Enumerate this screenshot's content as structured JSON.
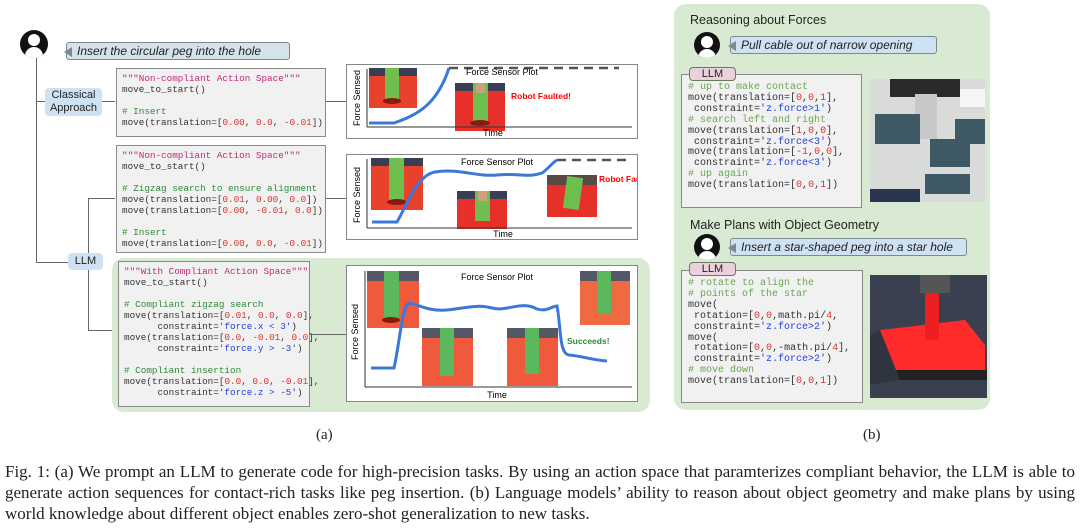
{
  "panel_a": {
    "user_prompt": "Insert the circular peg into the hole",
    "classical_label": "Classical Approach",
    "llm_label": "LLM",
    "code_blocks": [
      [
        [
          [
            "s",
            "\"\"\"Non-compliant Action Space\"\"\""
          ]
        ],
        [
          [
            "d",
            "move_to_start()"
          ]
        ],
        [],
        [
          [
            "c",
            "# Insert"
          ]
        ],
        [
          [
            "d",
            "move(translation=["
          ],
          [
            "n",
            "0.00"
          ],
          [
            "d",
            ", "
          ],
          [
            "n",
            "0.0"
          ],
          [
            "d",
            ", "
          ],
          [
            "n",
            "-0.01"
          ],
          [
            "d",
            "])"
          ]
        ]
      ],
      [
        [
          [
            "s",
            "\"\"\"Non-compliant Action Space\"\"\""
          ]
        ],
        [
          [
            "d",
            "move_to_start()"
          ]
        ],
        [],
        [
          [
            "c",
            "# Zigzag search to ensure alignment"
          ]
        ],
        [
          [
            "d",
            "move(translation=["
          ],
          [
            "n",
            "0.01"
          ],
          [
            "d",
            ", "
          ],
          [
            "n",
            "0.00"
          ],
          [
            "d",
            ", "
          ],
          [
            "n",
            "0.0"
          ],
          [
            "d",
            "])"
          ]
        ],
        [
          [
            "d",
            "move(translation=["
          ],
          [
            "n",
            "0.00"
          ],
          [
            "d",
            ", "
          ],
          [
            "n",
            "-0.01"
          ],
          [
            "d",
            ", "
          ],
          [
            "n",
            "0.0"
          ],
          [
            "d",
            "])"
          ]
        ],
        [],
        [
          [
            "c",
            "# Insert"
          ]
        ],
        [
          [
            "d",
            "move(translation=["
          ],
          [
            "n",
            "0.00"
          ],
          [
            "d",
            ", "
          ],
          [
            "n",
            "0.0"
          ],
          [
            "d",
            ", "
          ],
          [
            "n",
            "-0.01"
          ],
          [
            "d",
            "])"
          ]
        ]
      ],
      [
        [
          [
            "s",
            "\"\"\"With Compliant Action Space\"\"\""
          ]
        ],
        [
          [
            "d",
            "move_to_start()"
          ]
        ],
        [],
        [
          [
            "c",
            "# Compliant zigzag search"
          ]
        ],
        [
          [
            "d",
            "move(translation=["
          ],
          [
            "n",
            "0.01"
          ],
          [
            "d",
            ", "
          ],
          [
            "n",
            "0.0"
          ],
          [
            "d",
            ", "
          ],
          [
            "n",
            "0.0"
          ],
          [
            "d",
            "],"
          ]
        ],
        [
          [
            "d",
            "      constraint="
          ],
          [
            "q",
            "'force.x < 3'"
          ],
          [
            "d",
            ")"
          ]
        ],
        [
          [
            "d",
            "move(translation=["
          ],
          [
            "n",
            "0.0"
          ],
          [
            "d",
            ", "
          ],
          [
            "n",
            "-0.01"
          ],
          [
            "d",
            ", "
          ],
          [
            "n",
            "0.0"
          ],
          [
            "d",
            "],"
          ]
        ],
        [
          [
            "d",
            "      constraint="
          ],
          [
            "q",
            "'force.y > -3'"
          ],
          [
            "d",
            ")"
          ]
        ],
        [],
        [
          [
            "c",
            "# Compliant insertion"
          ]
        ],
        [
          [
            "d",
            "move(translation=["
          ],
          [
            "n",
            "0.0"
          ],
          [
            "d",
            ", "
          ],
          [
            "n",
            "0.0"
          ],
          [
            "d",
            ", "
          ],
          [
            "n",
            "-0.01"
          ],
          [
            "d",
            "],"
          ]
        ],
        [
          [
            "d",
            "      constraint="
          ],
          [
            "q",
            "'force.z > -5'"
          ],
          [
            "d",
            ")"
          ]
        ]
      ]
    ],
    "plots": [
      {
        "title": "Force Sensor Plot",
        "ylabel": "Force Sensed",
        "xlabel": "Time",
        "status": "Robot Faulted!",
        "status_color": "#ff0000"
      },
      {
        "title": "Force Sensor Plot",
        "ylabel": "Force Sensed",
        "xlabel": "Time",
        "status": "Robot Faulted!",
        "status_color": "#ff0000"
      },
      {
        "title": "Force Sensor Plot",
        "ylabel": "Force Sensed",
        "xlabel": "Time",
        "status": "Succeeds!",
        "status_color": "#2e8b3a"
      }
    ],
    "sublabel": "(a)"
  },
  "panel_b": {
    "sections": [
      {
        "title": "Reasoning about Forces",
        "user_prompt": "Pull cable out of narrow opening",
        "llm_label": "LLM",
        "code": [
          [
            [
              "c",
              "# up to make contact"
            ]
          ],
          [
            [
              "d",
              "move(translation=["
            ],
            [
              "n",
              "0"
            ],
            [
              "d",
              ","
            ],
            [
              "n",
              "0"
            ],
            [
              "d",
              ","
            ],
            [
              "n",
              "1"
            ],
            [
              "d",
              "],"
            ]
          ],
          [
            [
              "d",
              " constraint="
            ],
            [
              "q",
              "'z.force>1'"
            ],
            [
              "d",
              ")"
            ]
          ],
          [
            [
              "c",
              "# search left and right"
            ]
          ],
          [
            [
              "d",
              "move(translation=["
            ],
            [
              "n",
              "1"
            ],
            [
              "d",
              ","
            ],
            [
              "n",
              "0"
            ],
            [
              "d",
              ","
            ],
            [
              "n",
              "0"
            ],
            [
              "d",
              "],"
            ]
          ],
          [
            [
              "d",
              " constraint="
            ],
            [
              "q",
              "'z.force<3'"
            ],
            [
              "d",
              ")"
            ]
          ],
          [
            [
              "d",
              "move(translation=["
            ],
            [
              "n",
              "-1"
            ],
            [
              "d",
              ","
            ],
            [
              "n",
              "0"
            ],
            [
              "d",
              ","
            ],
            [
              "n",
              "0"
            ],
            [
              "d",
              "],"
            ]
          ],
          [
            [
              "d",
              " constraint="
            ],
            [
              "q",
              "'z.force<3'"
            ],
            [
              "d",
              ")"
            ]
          ],
          [
            [
              "c",
              "# up again"
            ]
          ],
          [
            [
              "d",
              "move(translation=["
            ],
            [
              "n",
              "0"
            ],
            [
              "d",
              ","
            ],
            [
              "n",
              "0"
            ],
            [
              "d",
              ","
            ],
            [
              "n",
              "1"
            ],
            [
              "d",
              "])"
            ]
          ]
        ]
      },
      {
        "title": "Make Plans with Object Geometry",
        "user_prompt": "Insert a star-shaped peg into a star hole",
        "llm_label": "LLM",
        "code": [
          [
            [
              "c",
              "# rotate to align the"
            ]
          ],
          [
            [
              "c",
              "# points of the star"
            ]
          ],
          [
            [
              "d",
              "move("
            ]
          ],
          [
            [
              "d",
              " rotation=["
            ],
            [
              "n",
              "0"
            ],
            [
              "d",
              ","
            ],
            [
              "n",
              "0"
            ],
            [
              "d",
              ",math.pi/"
            ],
            [
              "n",
              "4"
            ],
            [
              "d",
              ","
            ]
          ],
          [
            [
              "d",
              " constraint="
            ],
            [
              "q",
              "'z.force>2'"
            ],
            [
              "d",
              ")"
            ]
          ],
          [
            [
              "d",
              "move("
            ]
          ],
          [
            [
              "d",
              " rotation=["
            ],
            [
              "n",
              "0"
            ],
            [
              "d",
              ","
            ],
            [
              "n",
              "0"
            ],
            [
              "d",
              ",-math.pi/"
            ],
            [
              "n",
              "4"
            ],
            [
              "d",
              "],"
            ]
          ],
          [
            [
              "d",
              " constraint="
            ],
            [
              "q",
              "'z.force>2'"
            ],
            [
              "d",
              ")"
            ]
          ],
          [
            [
              "c",
              "# move down"
            ]
          ],
          [
            [
              "d",
              "move(translation=["
            ],
            [
              "n",
              "0"
            ],
            [
              "d",
              ","
            ],
            [
              "n",
              "0"
            ],
            [
              "d",
              ","
            ],
            [
              "n",
              "1"
            ],
            [
              "d",
              "])"
            ]
          ]
        ]
      }
    ],
    "sublabel": "(b)"
  },
  "caption": "Fig. 1: (a) We prompt an LLM to generate code for high-precision tasks. By using an action space that paramterizes compliant behavior, the LLM is able to generate action sequences for contact-rich tasks like peg insertion. (b) Language models’ ability to reason about object geometry and make plans by using world knowledge about different object enables zero-shot generalization to new tasks.",
  "colors": {
    "panel_green": "#d9ead3",
    "bubble_blue": "#d4e3ea",
    "llm_tag_pink": "#ead1dc",
    "curve_blue": "#3c78d8"
  }
}
